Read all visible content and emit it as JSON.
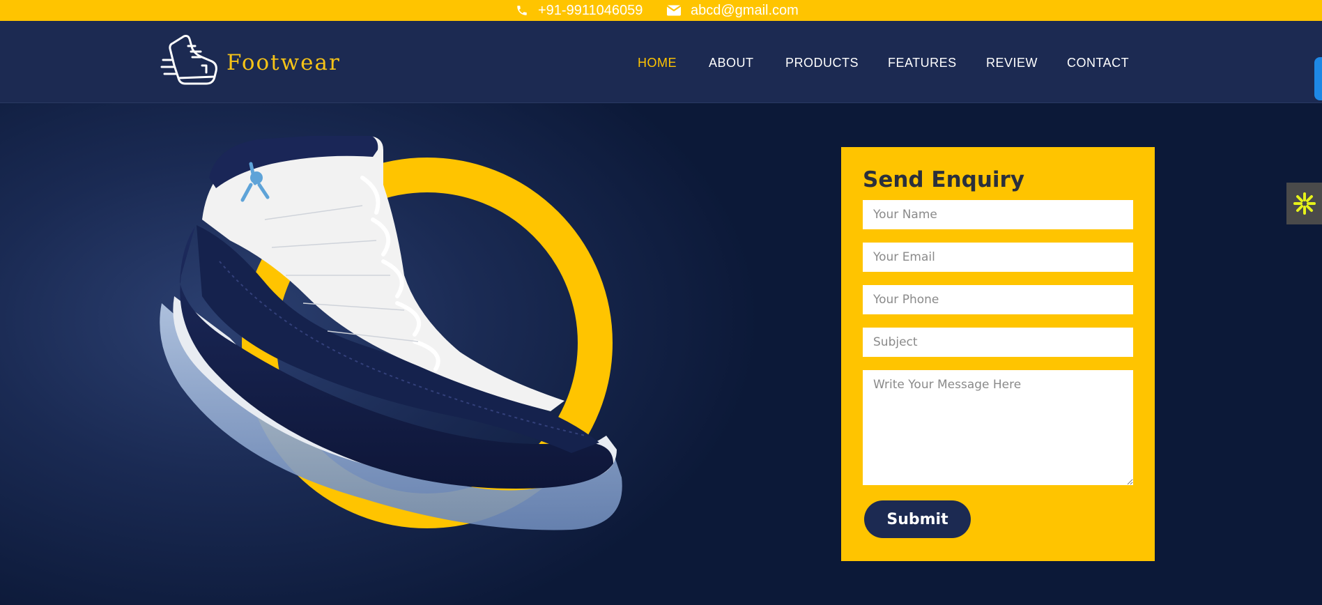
{
  "topbar": {
    "phone": "+91-9911046059",
    "email": "abcd@gmail.com",
    "phone_icon": "phone-icon",
    "email_icon": "envelope-icon"
  },
  "brand": {
    "name": "Footwear",
    "logo_icon": "running-shoe-logo-icon"
  },
  "nav": {
    "items": [
      {
        "label": "HOME",
        "active": true
      },
      {
        "label": "ABOUT",
        "active": false
      },
      {
        "label": "PRODUCTS",
        "active": false
      },
      {
        "label": "FEATURES",
        "active": false
      },
      {
        "label": "REVIEW",
        "active": false
      },
      {
        "label": "CONTACT",
        "active": false
      }
    ]
  },
  "enquiry": {
    "title": "Send Enquiry",
    "name_placeholder": "Your Name",
    "email_placeholder": "Your Email",
    "phone_placeholder": "Your Phone",
    "subject_placeholder": "Subject",
    "message_placeholder": "Write Your Message Here",
    "submit_label": "Submit"
  },
  "side_widget": {
    "icon": "asterisk-icon"
  },
  "colors": {
    "accent": "#ffc400",
    "navy": "#1c2a52",
    "dark_bg": "#0d1937",
    "widget_icon": "#e6f21a"
  }
}
